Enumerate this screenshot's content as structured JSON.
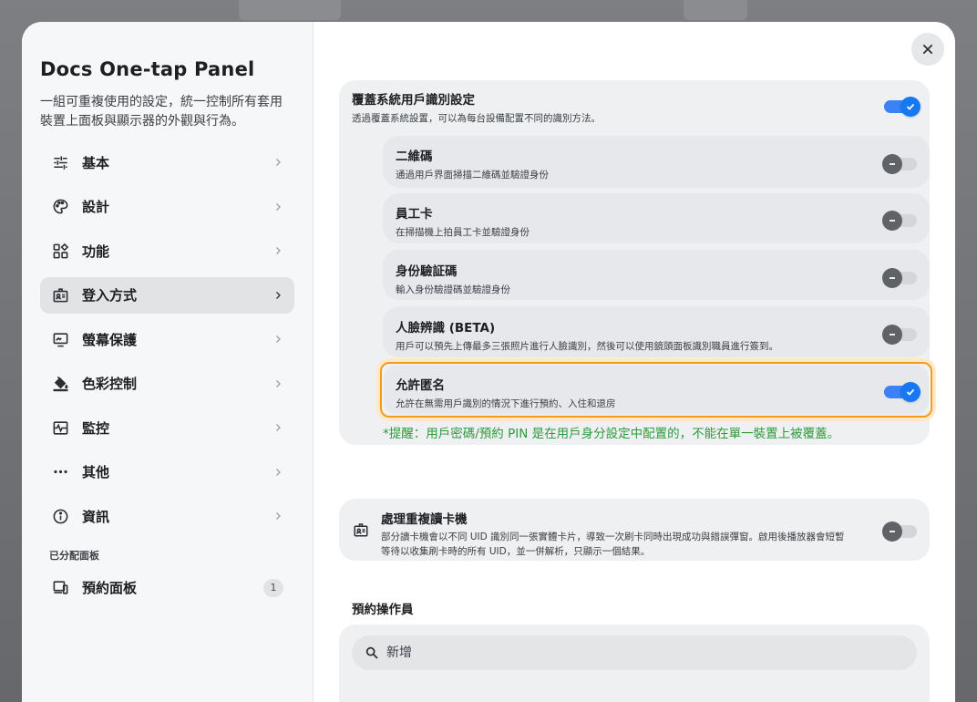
{
  "sidebar": {
    "title": "Docs One-tap Panel",
    "description": "一組可重複使用的設定，統一控制所有套用裝置上面板與顯示器的外觀與行為。",
    "items": [
      {
        "label": "基本",
        "icon": "sliders-icon"
      },
      {
        "label": "設計",
        "icon": "palette-icon"
      },
      {
        "label": "功能",
        "icon": "widgets-icon"
      },
      {
        "label": "登入方式",
        "icon": "id-badge-icon",
        "active": true
      },
      {
        "label": "螢幕保護",
        "icon": "screensaver-icon"
      },
      {
        "label": "色彩控制",
        "icon": "paint-bucket-icon"
      },
      {
        "label": "監控",
        "icon": "monitor-heartbeat-icon"
      },
      {
        "label": "其他",
        "icon": "more-horiz-icon"
      },
      {
        "label": "資訊",
        "icon": "info-icon"
      }
    ],
    "assigned_section_label": "已分配面板",
    "assigned_items": [
      {
        "label": "預約面板",
        "icon": "devices-icon",
        "count": "1"
      }
    ]
  },
  "override": {
    "title": "覆蓋系統用戶識別設定",
    "desc": "透過覆蓋系統設置，可以為每台設備配置不同的識別方法。",
    "on": true
  },
  "methods": [
    {
      "title": "二維碼",
      "desc": "通過用戶界面掃描二維碼並驗證身份",
      "on": false
    },
    {
      "title": "員工卡",
      "desc": "在掃描機上拍員工卡並驗證身份",
      "on": false
    },
    {
      "title": "身份驗証碼",
      "desc": "輸入身份驗證碼並驗證身份",
      "on": false
    },
    {
      "title": "人臉辨識 (BETA)",
      "desc": "用戶可以預先上傳最多三張照片進行人臉識別，然後可以使用鏡頭面板識別職員進行簽到。",
      "on": false
    },
    {
      "title": "允許匿名",
      "desc": "允許在無需用戶識別的情況下進行預約、入住和退房",
      "on": true
    }
  ],
  "reminder": "*提醒：用戶密碼/預約 PIN 是在用戶身分設定中配置的，不能在單一裝置上被覆蓋。",
  "duplicate_reader": {
    "title": "處理重複讀卡機",
    "desc_line1": "部分讀卡機會以不同 UID 識別同一張實體卡片，導致一次刷卡同時出現成功與錯誤彈窗。啟用後播放器會短暫",
    "desc_line2": "等待以收集刷卡時的所有 UID，並一併解析，只顯示一個結果。",
    "on": false
  },
  "operators": {
    "title": "預約操作員",
    "search_placeholder": "新增"
  },
  "colors": {
    "accent": "#1877f2",
    "highlight": "#f39b1e",
    "reminder": "#2f9a3c"
  }
}
